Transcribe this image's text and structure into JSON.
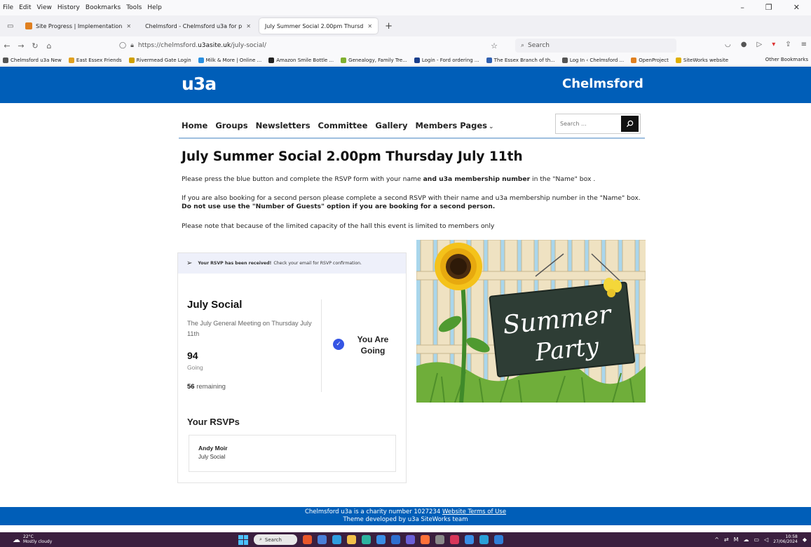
{
  "browser": {
    "menu": [
      "File",
      "Edit",
      "View",
      "History",
      "Bookmarks",
      "Tools",
      "Help"
    ],
    "window_controls": [
      "–",
      "❐",
      "✕"
    ],
    "tabs": [
      {
        "label": "Site Progress | Implementation",
        "active": false
      },
      {
        "label": "Chelmsford - Chelmsford u3a for p",
        "active": false
      },
      {
        "label": "July Summer Social 2.00pm Thursd",
        "active": true
      }
    ],
    "url_prefix": "https://chelmsford.",
    "url_domain": "u3asite.uk",
    "url_path": "/july-social/",
    "search_placeholder": "Search",
    "bookmarks": [
      {
        "label": "Chelmsford u3a New",
        "color": "#555555"
      },
      {
        "label": "East Essex Friends",
        "color": "#e0a020"
      },
      {
        "label": "Rivermead Gate Login",
        "color": "#d0a000"
      },
      {
        "label": "Milk & More | Online ...",
        "color": "#2a8fe0"
      },
      {
        "label": "Amazon Smile Bottle ...",
        "color": "#222222"
      },
      {
        "label": "Genealogy, Family Tre...",
        "color": "#80b030"
      },
      {
        "label": "Login - Ford ordering ...",
        "color": "#1a3e8c"
      },
      {
        "label": "The Essex Branch of th...",
        "color": "#3060b0"
      },
      {
        "label": "Log In ‹ Chelmsford ...",
        "color": "#555555"
      },
      {
        "label": "OpenProject",
        "color": "#e08020"
      },
      {
        "label": "SiteWorks website",
        "color": "#e0b000"
      }
    ],
    "other_bookmarks": "Other Bookmarks"
  },
  "site": {
    "logo": "u3a",
    "name": "Chelmsford",
    "nav": [
      "Home",
      "Groups",
      "Newsletters",
      "Committee",
      "Gallery",
      "Members Pages"
    ],
    "search_placeholder": "Search ..."
  },
  "page": {
    "title": "July Summer Social 2.00pm Thursday July 11th",
    "p1_a": "Please press the blue button and complete the RSVP form with your name ",
    "p1_b": "and u3a membership number",
    "p1_c": " in the \"Name\" box .",
    "p2_a": "If you are also booking for a second person please complete a second RSVP with their name and u3a membership number in the \"Name\" box.",
    "p2_b": "Do not use use the \"Number of Guests\" option if you are booking for a second person.",
    "p3": "Please note that because of the limited capacity of the hall this event is limited to members only"
  },
  "rsvp": {
    "banner_bold": "Your RSVP has been received!",
    "banner_text": "Check your email for RSVP confirmation.",
    "event_title": "July Social",
    "event_desc": "The July General Meeting on Thursday July 11th",
    "going_count": "94",
    "going_label": "Going",
    "remaining_count": "56",
    "remaining_label": " remaining",
    "status": "You Are Going",
    "your_rsvps": "Your RSVPs",
    "rsvp_name": "Andy Moir",
    "rsvp_event": "July Social"
  },
  "image": {
    "line1": "Summer",
    "line2": "Party"
  },
  "footer": {
    "line1_text": "Chelmsford u3a is a charity number 1027234 ",
    "line1_link": "Website Terms of Use",
    "line2": "Theme developed by u3a SiteWorks team"
  },
  "taskbar": {
    "temp": "22°C",
    "weather": "Mostly cloudy",
    "search": "Search",
    "time": "10:58",
    "date": "27/06/2024"
  },
  "colors": {
    "brand": "#005eb8",
    "check": "#3555e4",
    "taskbar": "#3b1f3f"
  }
}
